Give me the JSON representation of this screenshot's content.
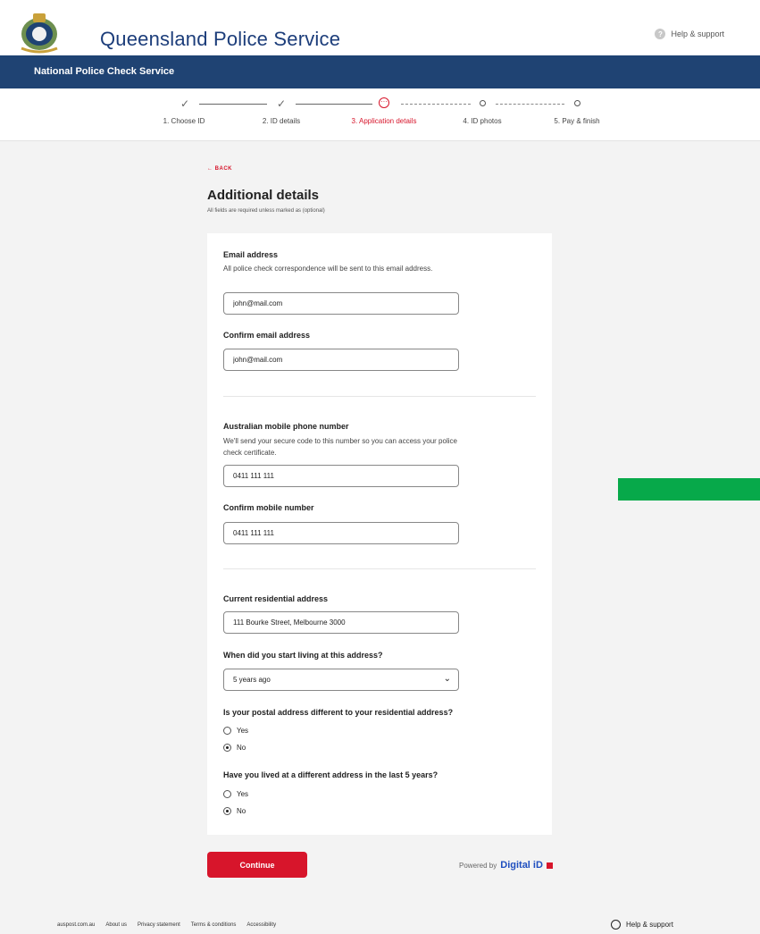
{
  "header": {
    "brand": "Queensland Police Service",
    "help_label": "Help & support",
    "service_name": "National Police Check Service"
  },
  "stepper": {
    "steps": [
      {
        "label": "1. Choose ID",
        "state": "done"
      },
      {
        "label": "2. ID details",
        "state": "done"
      },
      {
        "label": "3. Application details",
        "state": "current"
      },
      {
        "label": "4. ID photos",
        "state": "future"
      },
      {
        "label": "5. Pay & finish",
        "state": "future"
      }
    ],
    "done_glyph": "✓",
    "current_glyph": "···"
  },
  "page": {
    "back_label": "← BACK",
    "title": "Additional details",
    "subtitle": "All fields are required unless marked as (optional)"
  },
  "form": {
    "email": {
      "label": "Email address",
      "hint": "All police check correspondence will be sent to this email address.",
      "value": "john@mail.com"
    },
    "confirm_email": {
      "label": "Confirm email address",
      "value": "john@mail.com"
    },
    "mobile": {
      "label": "Australian mobile phone number",
      "hint": "We'll send your secure code to this number so you can access your police check certificate.",
      "value": "0411 111 111"
    },
    "confirm_mobile": {
      "label": "Confirm mobile number",
      "value": "0411 111 111"
    },
    "address": {
      "label": "Current residential address",
      "value": "111 Bourke Street, Melbourne 3000"
    },
    "living_since": {
      "label": "When did you start living at this address?",
      "selected": "5 years ago"
    },
    "postal_different": {
      "question": "Is your postal address different to your residential address?",
      "options": [
        {
          "label": "Yes",
          "checked": false
        },
        {
          "label": "No",
          "checked": true
        }
      ]
    },
    "lived_elsewhere": {
      "question": "Have you lived at a different address in the last 5 years?",
      "options": [
        {
          "label": "Yes",
          "checked": false
        },
        {
          "label": "No",
          "checked": true
        }
      ]
    }
  },
  "actions": {
    "continue_label": "Continue",
    "powered_by": "Powered by",
    "powered_brand": "Digital iD"
  },
  "footer": {
    "links": [
      "auspost.com.au",
      "About us",
      "Privacy statement",
      "Terms & conditions",
      "Accessibility"
    ],
    "help_label": "Help & support"
  },
  "colors": {
    "navy": "#1f4373",
    "accent_red": "#d7152b",
    "green": "#07a94a"
  }
}
